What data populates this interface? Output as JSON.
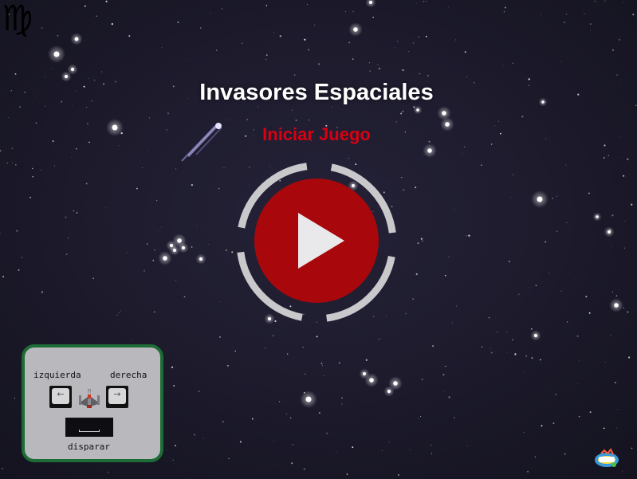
{
  "game": {
    "title": "Invasores Espaciales",
    "start_label": "Iniciar Juego"
  },
  "controls": {
    "left_label": "izquierda",
    "right_label": "derecha",
    "fire_label": "disparar",
    "left_key_glyph": "←",
    "right_key_glyph": "→"
  },
  "icons": {
    "zodiac": "virgo-icon",
    "play": "play-icon",
    "ship": "spaceship-icon",
    "badge": "game-logo-icon"
  },
  "colors": {
    "background": "#1a1828",
    "title": "#ffffff",
    "start_label": "#d80012",
    "play_button": "#a8080c",
    "play_ring": "#c9c9cc",
    "controls_panel": "#b9b8bd",
    "controls_border": "#1d6b35"
  }
}
